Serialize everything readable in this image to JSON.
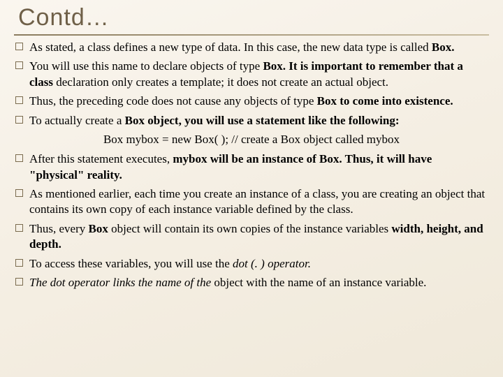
{
  "title": "Contd…",
  "bullets": [
    {
      "html": "As stated, a class defines a new type of data. In this case, the new data type is called <b>Box.</b>"
    },
    {
      "html": "You will use this name to declare objects of type <b>Box. It is important to remember that a class</b> declaration only creates a template; it does not create an actual object."
    },
    {
      "html": "Thus, the preceding code does not cause any objects of type <b>Box to come into existence.</b>"
    },
    {
      "html": "To actually create a <b>Box object, you will use a statement like the following:</b>"
    },
    {
      "html": "After this statement executes, <b>mybox will be an instance of Box. Thus, it will have \"physical\" reality.</b>"
    },
    {
      "html": "As mentioned earlier, each time you create an instance of a class, you are creating an object that contains its own copy of each instance variable defined by the class."
    },
    {
      "html": "Thus, every <b>Box</b> object will contain its own copies of the instance variables <b>width, height, and depth.</b>"
    },
    {
      "html": "To access these variables, you will use the <i>dot (. ) operator.</i>"
    },
    {
      "html": "<i>The dot operator links the name of the</i> object with the name of an instance variable."
    }
  ],
  "code_line": "Box mybox = new Box( );   // create a Box object called mybox"
}
